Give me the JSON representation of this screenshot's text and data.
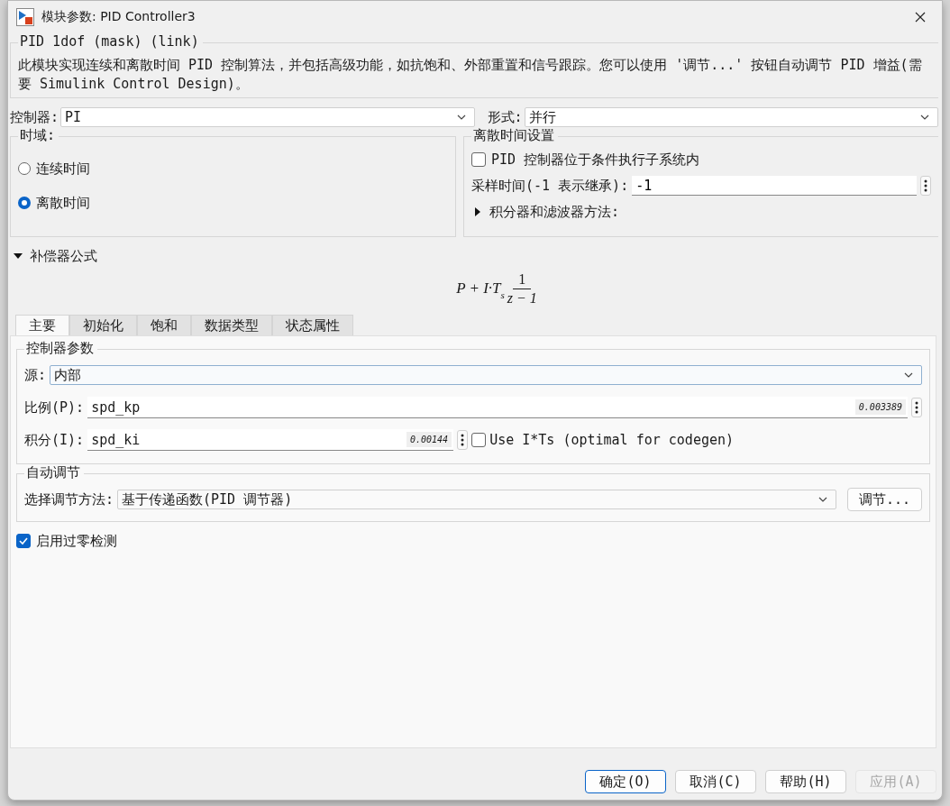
{
  "window": {
    "title": "模块参数: PID Controller3"
  },
  "mask": {
    "title": "PID 1dof (mask) (link)",
    "description": "此模块实现连续和离散时间 PID 控制算法，并包括高级功能，如抗饱和、外部重置和信号跟踪。您可以使用 '调节...' 按钮自动调节 PID 增益(需要 Simulink Control Design)。"
  },
  "controller": {
    "label": "控制器:",
    "value": "PI"
  },
  "form": {
    "label": "形式:",
    "value": "并行"
  },
  "time_domain": {
    "title": "时域:",
    "options": [
      {
        "label": "连续时间",
        "selected": false
      },
      {
        "label": "离散时间",
        "selected": true
      }
    ]
  },
  "discrete_settings": {
    "title": "离散时间设置",
    "conditional": {
      "label": "PID 控制器位于条件执行子系统内",
      "checked": false
    },
    "sample_time": {
      "label": "采样时间(-1 表示继承):",
      "value": "-1"
    },
    "integrator_method": {
      "label": "积分器和滤波器方法:",
      "expanded": false
    }
  },
  "compensator": {
    "label": "补偿器公式",
    "expanded": true,
    "formula": {
      "main": "P + I·T",
      "subscript": "s",
      "numerator": "1",
      "denominator": "z − 1"
    }
  },
  "tabs": [
    {
      "label": "主要",
      "selected": true
    },
    {
      "label": "初始化",
      "selected": false
    },
    {
      "label": "饱和",
      "selected": false
    },
    {
      "label": "数据类型",
      "selected": false
    },
    {
      "label": "状态属性",
      "selected": false
    }
  ],
  "controller_parameters": {
    "title": "控制器参数",
    "source": {
      "label": "源:",
      "value": "内部"
    },
    "proportional": {
      "label": "比例(P):",
      "value": "spd_kp",
      "evaluated": "0.003389"
    },
    "integral": {
      "label": "积分(I):",
      "value": "spd_ki",
      "evaluated": "0.00144"
    },
    "use_its": {
      "label": "Use I*Ts (optimal for codegen)",
      "checked": false
    }
  },
  "auto_tune": {
    "title": "自动调节",
    "method_label": "选择调节方法:",
    "method": "基于传递函数(PID 调节器)",
    "tune_button": "调节..."
  },
  "zero_crossing": {
    "label": "启用过零检测",
    "checked": true
  },
  "buttons": [
    {
      "label": "确定(O)",
      "kind": "default",
      "disabled": false
    },
    {
      "label": "取消(C)",
      "kind": "normal",
      "disabled": false
    },
    {
      "label": "帮助(H)",
      "kind": "normal",
      "disabled": false
    },
    {
      "label": "应用(A)",
      "kind": "normal",
      "disabled": true
    }
  ]
}
